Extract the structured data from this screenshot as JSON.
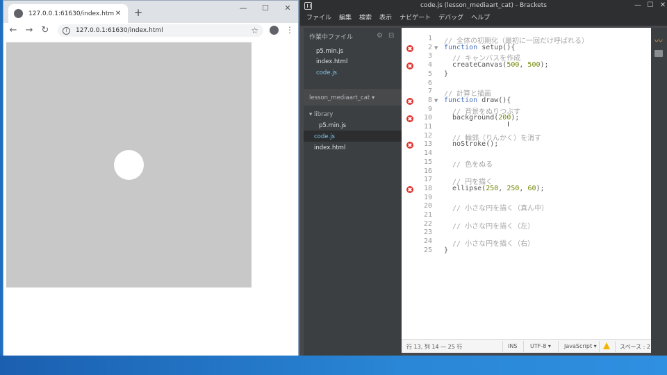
{
  "chrome": {
    "tab_title": "127.0.0.1:61630/index.html",
    "tab_close": "✕",
    "new_tab": "+",
    "minimize": "—",
    "maximize": "☐",
    "close": "✕",
    "back": "←",
    "forward": "→",
    "reload": "↻",
    "url": "127.0.0.1:61630/index.html",
    "info": "i",
    "star": "☆",
    "menu": "⋮"
  },
  "brackets": {
    "title": "code.js (lesson_mediaart_cat) - Brackets",
    "win_min": "—",
    "win_max": "☐",
    "win_close": "✕",
    "menu": [
      "ファイル",
      "編集",
      "検索",
      "表示",
      "ナビゲート",
      "デバッグ",
      "ヘルプ"
    ],
    "working_files_header": "作業中ファイル",
    "working_files": [
      "p5.min.js",
      "index.html",
      "code.js"
    ],
    "project_name": "lesson_mediaart_cat ▾",
    "tree": {
      "folder": "▾ library",
      "folder_child": "p5.min.js",
      "items": [
        "code.js",
        "index.html"
      ]
    },
    "lines": [
      {
        "n": "1",
        "text": "// 全体の初期化（最初に一回だけ呼ばれる）"
      },
      {
        "n": "2",
        "kw": "function",
        "rest": " setup(){"
      },
      {
        "n": "3",
        "text": "  // キャンバスを作成"
      },
      {
        "n": "4",
        "fn": "  createCanvas(",
        "nums": [
          "500",
          "500"
        ],
        "tail": ");"
      },
      {
        "n": "5",
        "plain": "}"
      },
      {
        "n": "6",
        "plain": ""
      },
      {
        "n": "7",
        "text": "// 計算と描画"
      },
      {
        "n": "8",
        "kw": "function",
        "rest": " draw(){"
      },
      {
        "n": "9",
        "text": "  // 背景をぬりつぶす"
      },
      {
        "n": "10",
        "fn": "  background(",
        "nums": [
          "200"
        ],
        "tail": ");"
      },
      {
        "n": "11",
        "plain": ""
      },
      {
        "n": "12",
        "text": "  // 輪郭（りんかく）を消す"
      },
      {
        "n": "13",
        "plain": "  noStroke();"
      },
      {
        "n": "14",
        "plain": ""
      },
      {
        "n": "15",
        "text": "  // 色をぬる"
      },
      {
        "n": "16",
        "plain": ""
      },
      {
        "n": "17",
        "text": "  // 円を描く"
      },
      {
        "n": "18",
        "fn": "  ellipse(",
        "nums": [
          "250",
          "250",
          "60"
        ],
        "tail": ");"
      },
      {
        "n": "19",
        "plain": ""
      },
      {
        "n": "20",
        "text": "  // 小さな円を描く（真ん中）"
      },
      {
        "n": "21",
        "plain": ""
      },
      {
        "n": "22",
        "text": "  // 小さな円を描く（左）"
      },
      {
        "n": "23",
        "plain": ""
      },
      {
        "n": "24",
        "text": "  // 小さな円を描く（右）"
      },
      {
        "n": "25",
        "plain": "}"
      }
    ],
    "error_lines": [
      2,
      4,
      8,
      10,
      13,
      18
    ],
    "fold_lines": [
      2,
      8
    ],
    "status": {
      "position": "行 13, 列 14 — 25 行",
      "ins": "INS",
      "encoding": "UTF-8 ▾",
      "language": "JavaScript ▾",
      "spaces": "スペース : 2"
    }
  },
  "colors": {
    "canvas_bg": "#c8c8c8",
    "circle": "#ffffff",
    "error": "#e0312c",
    "keyword": "#446fbd",
    "number": "#6d8600"
  }
}
